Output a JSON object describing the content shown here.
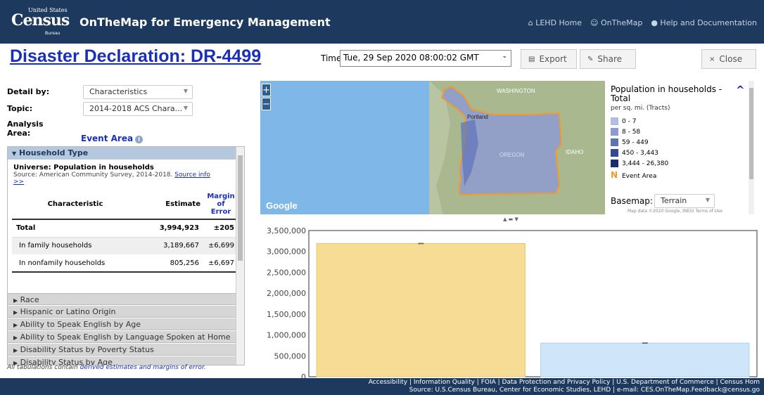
{
  "header": {
    "logo_us": "United States",
    "logo_census": "Census",
    "logo_bureau": "Bureau",
    "title": "OnTheMap for Emergency Management",
    "links": [
      "LEHD Home",
      "OnTheMap",
      "Help and Documentation"
    ]
  },
  "toolbar": {
    "page_title": "Disaster Declaration: DR-4499",
    "time_label": "Time",
    "time_value": "Tue, 29 Sep 2020 08:00:02 GMT",
    "export_label": "Export",
    "share_label": "Share",
    "close_label": "Close"
  },
  "left": {
    "detail_label": "Detail by:",
    "detail_value": "Characteristics",
    "topic_label": "Topic:",
    "topic_value": "2014-2018 ACS Chara...",
    "analysis_label_1": "Analysis",
    "analysis_label_2": "Area:",
    "analysis_value": "Event Area",
    "panel_title": "Household Type",
    "universe": "Universe: Population in households",
    "source_text": "Source: American Community Survey, 2014-2018.",
    "source_link": "Source info",
    "source_more": ">>",
    "table": {
      "headers": [
        "Characteristic",
        "Estimate",
        "Margin of Error"
      ],
      "rows": [
        {
          "label": "Total",
          "estimate": "3,994,923",
          "moe": "±205"
        },
        {
          "label": "In family households",
          "estimate": "3,189,667",
          "moe": "±6,699"
        },
        {
          "label": "In nonfamily households",
          "estimate": "805,256",
          "moe": "±6,697"
        }
      ]
    },
    "collapsed_sections": [
      "Race",
      "Hispanic or Latino Origin",
      "Ability to Speak English by Age",
      "Ability to Speak English by Language Spoken at Home",
      "Disability Status by Poverty Status",
      "Disability Status by Age"
    ],
    "footnote_prefix": "All tabulations contain",
    "footnote_link": "derived estimates and margins of error",
    "footnote_suffix": "."
  },
  "map": {
    "labels": [
      "WASHINGTON",
      "IDAHO",
      "Portland",
      "OREGON"
    ],
    "google": "Google",
    "attribution": "Map data ©2020 Google, INEGI   Terms of Use",
    "zoom_in": "+",
    "zoom_out": "−"
  },
  "legend": {
    "title": "Population in households - Total",
    "subtitle": "per sq. mi. (Tracts)",
    "items": [
      {
        "label": "0 - 7",
        "color": "#b3bde3"
      },
      {
        "label": "8 - 58",
        "color": "#8e9bd2"
      },
      {
        "label": "59 - 449",
        "color": "#5f72b8"
      },
      {
        "label": "450 - 3,443",
        "color": "#34479a"
      },
      {
        "label": "3,444 - 26,380",
        "color": "#1a2c75"
      }
    ],
    "event_label": "Event Area",
    "event_color": "#f39a2d",
    "basemap_label": "Basemap:",
    "basemap_value": "Terrain"
  },
  "chart_data": {
    "type": "bar",
    "categories": [
      "In family households",
      "In nonfamily households"
    ],
    "values": [
      3189667,
      805256
    ],
    "errors": [
      6699,
      6697
    ],
    "colors": [
      "#f7dc96",
      "#cfe6fa"
    ],
    "ylim": [
      0,
      3500000
    ],
    "yticks": [
      "0",
      "500,000",
      "1,000,000",
      "1,500,000",
      "2,000,000",
      "2,500,000",
      "3,000,000",
      "3,500,000"
    ]
  },
  "footer": {
    "line1": "Accessibility | Information Quality | FOIA | Data Protection and Privacy Policy | U.S. Department of Commerce | Census Hom",
    "line2": "Source: U.S.Census Bureau, Center for Economic Studies, LEHD | e-mail: CES.OnTheMap.Feedback@census.go"
  }
}
